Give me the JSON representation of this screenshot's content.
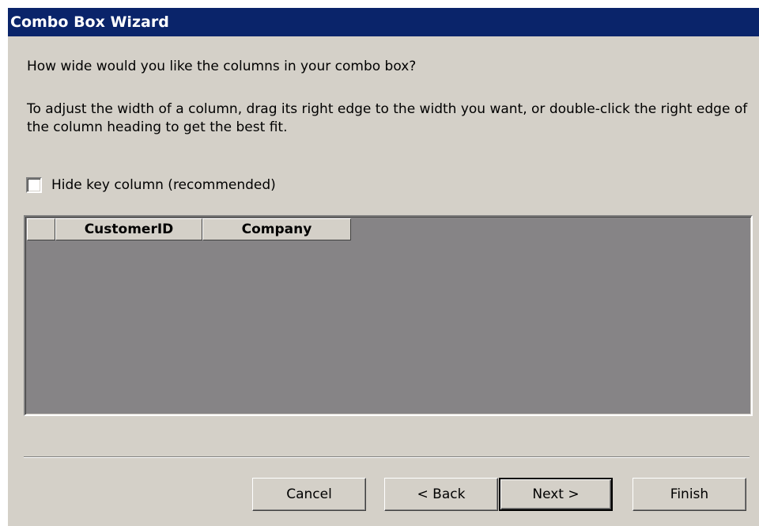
{
  "window": {
    "title": "Combo Box Wizard"
  },
  "content": {
    "question": "How wide would you like the columns in your combo box?",
    "instructions": "To adjust the width of a column, drag its right edge to the width you want, or double-click the right edge of the column heading to get the best fit.",
    "hide_key_column": {
      "label": "Hide key column (recommended)",
      "checked": false
    }
  },
  "grid": {
    "columns": [
      "CustomerID",
      "Company"
    ]
  },
  "buttons": {
    "cancel": "Cancel",
    "back": "< Back",
    "next": "Next >",
    "finish": "Finish",
    "default": "next"
  },
  "colors": {
    "titlebar": "#0a246a",
    "dialog_face": "#d4d0c8",
    "grid_background": "#868486"
  }
}
